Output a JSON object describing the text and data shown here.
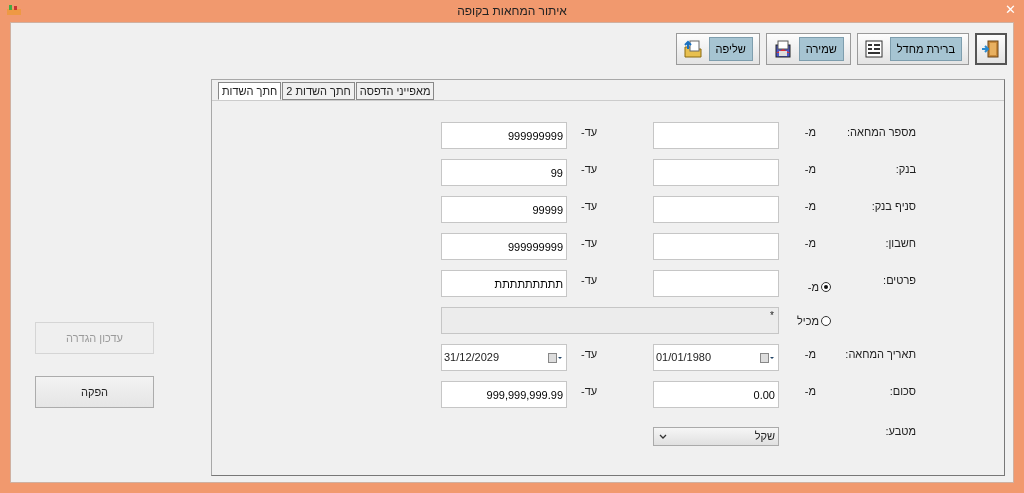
{
  "window": {
    "title": "איתור המחאות בקופה",
    "close": "✕"
  },
  "toolbar": [
    {
      "kind": "exit"
    },
    {
      "kind": "defaults",
      "label": "ברירת מחדל"
    },
    {
      "kind": "save",
      "label": "שמירה"
    },
    {
      "kind": "retrieve",
      "label": "שליפה"
    }
  ],
  "tabs": [
    {
      "label": "מאפייני הדפסה",
      "selected": false
    },
    {
      "label": "חתך השדות 2",
      "selected": false
    },
    {
      "label": "חתך השדות",
      "selected": true
    }
  ],
  "rows": [
    {
      "kind": "range",
      "label": "מספר המחאה:",
      "from_label": "מ-",
      "from": "",
      "to_label": "עד-",
      "to": "999999999"
    },
    {
      "kind": "range",
      "label": "בנק:",
      "from_label": "מ-",
      "from": "",
      "to_label": "עד-",
      "to": "99"
    },
    {
      "kind": "range",
      "label": "סניף בנק:",
      "from_label": "מ-",
      "from": "",
      "to_label": "עד-",
      "to": "99999"
    },
    {
      "kind": "range",
      "label": "חשבון:",
      "from_label": "מ-",
      "from": "",
      "to_label": "עד-",
      "to": "999999999"
    },
    {
      "kind": "radio_range",
      "label": "פרטים:",
      "from_label": "מ-",
      "selected": true,
      "from": "",
      "to_label": "עד-",
      "to": "תתתתתתתתת"
    },
    {
      "kind": "contains",
      "label": "מכיל",
      "selected": false,
      "value": "*"
    },
    {
      "kind": "date_range",
      "label": "תאריך המחאה:",
      "from_label": "מ-",
      "from": "01/01/1980",
      "to_label": "עד-",
      "to": "31/12/2029"
    },
    {
      "kind": "range",
      "label": "סכום:",
      "from_label": "מ-",
      "from": "0.00",
      "to_label": "עד-",
      "to": "999,999,999.99"
    },
    {
      "kind": "select",
      "label": "מטבע:",
      "value": "שקל"
    }
  ],
  "side_buttons": [
    {
      "label": "עדכון הגדרה",
      "disabled": true
    },
    {
      "label": "הפקה",
      "disabled": false
    }
  ]
}
